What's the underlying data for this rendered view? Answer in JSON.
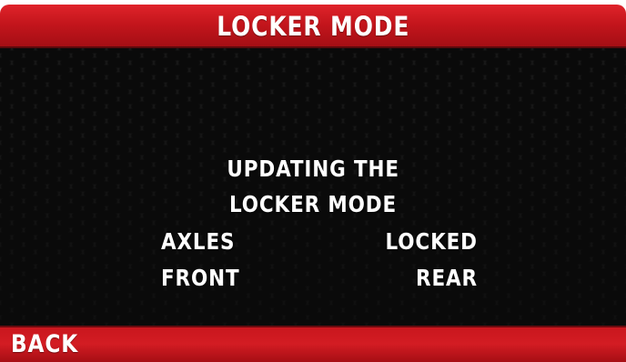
{
  "header": {
    "title": "LOCKER MODE"
  },
  "message": {
    "line1": "UPDATING THE",
    "line2": "LOCKER MODE"
  },
  "status": {
    "row1": {
      "left": "AXLES",
      "right": "LOCKED"
    },
    "row2": {
      "left": "FRONT",
      "right": "REAR"
    }
  },
  "footer": {
    "back_label": "BACK"
  },
  "colors": {
    "accent_red": "#c3151c",
    "background_dark": "#1a1a1a",
    "text": "#ffffff"
  }
}
